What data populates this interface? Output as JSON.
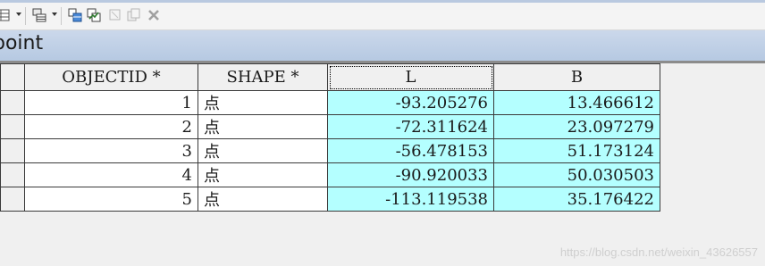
{
  "window": {
    "title": "point"
  },
  "toolbar": {
    "icons": [
      "table-options-icon",
      "related-tables-icon",
      "select-by-attributes-icon",
      "switch-selection-icon",
      "clear-selection-icon",
      "copy-selected-icon",
      "delete-selected-icon"
    ]
  },
  "table": {
    "columns": [
      "OBJECTID *",
      "SHAPE *",
      "L",
      "B"
    ],
    "rows": [
      {
        "objectid": "1",
        "shape": "点",
        "l": "-93.205276",
        "b": "13.466612"
      },
      {
        "objectid": "2",
        "shape": "点",
        "l": "-72.311624",
        "b": "23.097279"
      },
      {
        "objectid": "3",
        "shape": "点",
        "l": "-56.478153",
        "b": "51.173124"
      },
      {
        "objectid": "4",
        "shape": "点",
        "l": "-90.920033",
        "b": "50.030503"
      },
      {
        "objectid": "5",
        "shape": "点",
        "l": "-113.119538",
        "b": "35.176422"
      }
    ],
    "selected_column": "L",
    "selection_color": "#b4ffff"
  },
  "watermark": "https://blog.csdn.net/weixin_43626557"
}
